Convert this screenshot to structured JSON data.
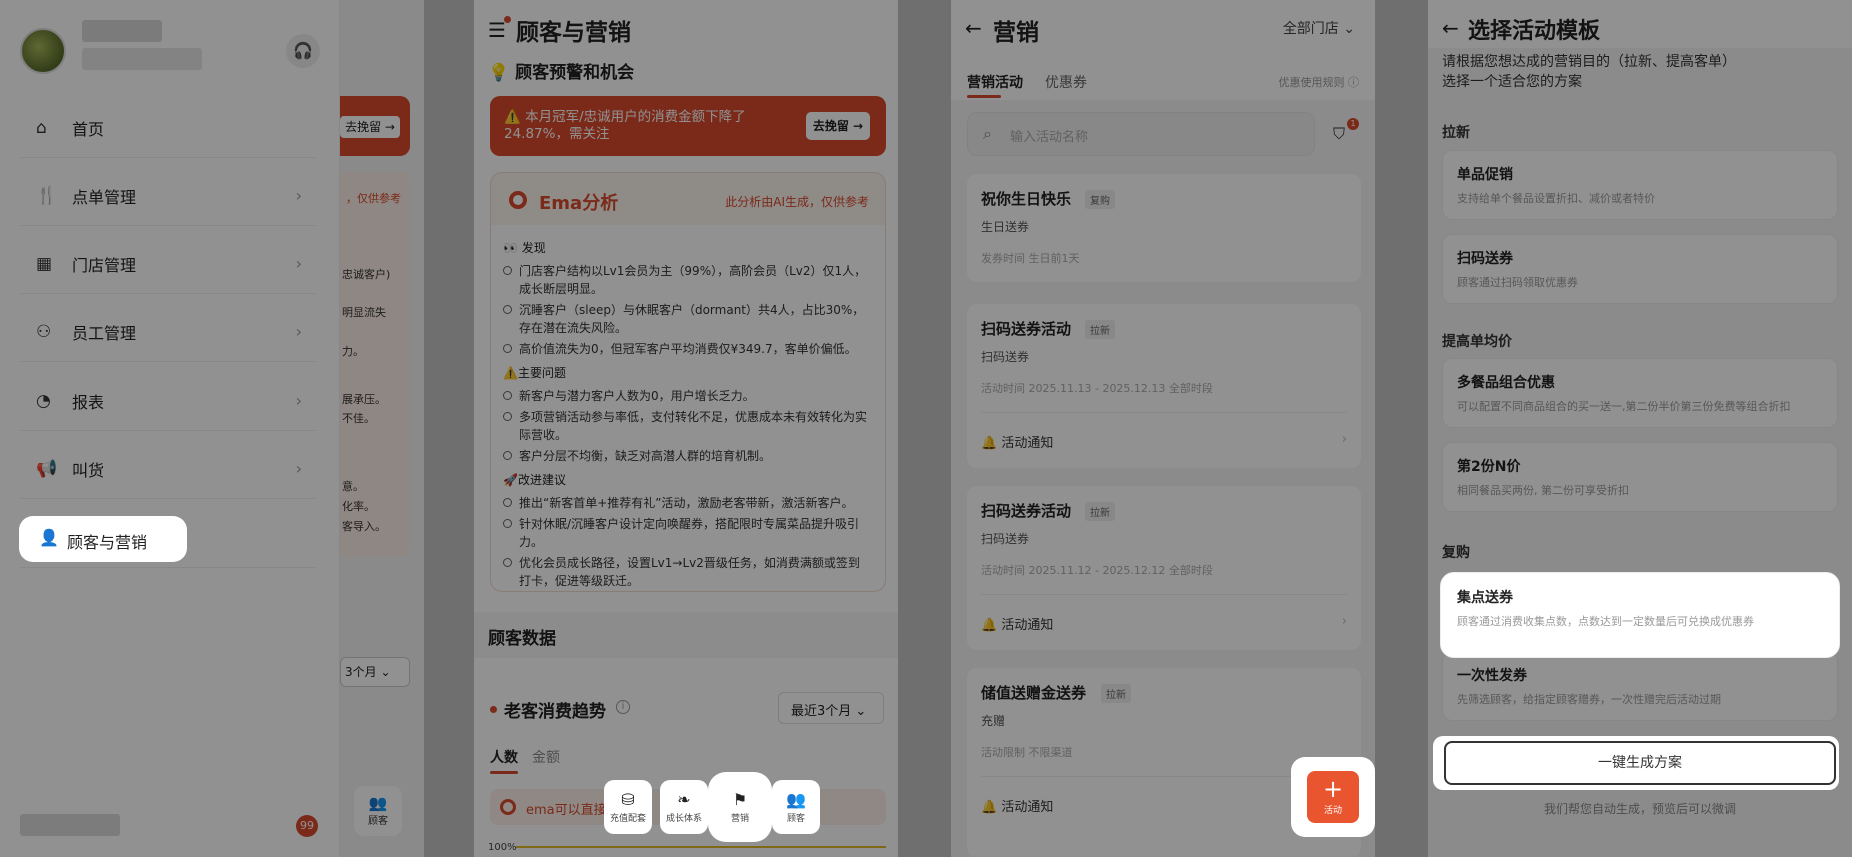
{
  "panel1": {
    "menu": [
      {
        "label": "首页",
        "icon": "home-icon",
        "glyph": "⌂",
        "chevron": false
      },
      {
        "label": "点单管理",
        "icon": "cutlery-icon",
        "glyph": "🍴",
        "chevron": true
      },
      {
        "label": "门店管理",
        "icon": "store-icon",
        "glyph": "▦",
        "chevron": true
      },
      {
        "label": "员工管理",
        "icon": "staff-icon",
        "glyph": "⚇",
        "chevron": true
      },
      {
        "label": "报表",
        "icon": "pie-chart-icon",
        "glyph": "◔",
        "chevron": true
      },
      {
        "label": "叫货",
        "icon": "megaphone-icon",
        "glyph": "📢",
        "chevron": true
      },
      {
        "label": "顾客与营销",
        "icon": "customer-marketing-icon",
        "glyph": "👤",
        "chevron": false
      }
    ],
    "badge": "99",
    "behind": {
      "button": "去挽留 →",
      "warn": "，仅供参考",
      "lines": [
        "忠诚客户)",
        "明显流失",
        "力。",
        "展承压。",
        "不佳。",
        "意。",
        "化率。",
        "客导入。"
      ],
      "select": "3个月 ⌄",
      "mini": "顾客"
    }
  },
  "panel2": {
    "title": "顾客与营销",
    "section": "顾客预警和机会",
    "alert": "⚠️ 本月冠军/忠诚用户的消费金额下降了24.87%，需关注",
    "alert_button": "去挽留 →",
    "ema_title": "Ema分析",
    "ema_note": "此分析由AI生成，仅供参考",
    "find_head": "👀 发现",
    "find": [
      "门店客户结构以Lv1会员为主（99%），高阶会员（Lv2）仅1人，成长断层明显。",
      "沉睡客户（sleep）与休眠客户（dormant）共4人，占比30%，存在潜在流失风险。",
      "高价值流失为0，但冠军客户平均消费仅¥349.7，客单价偏低。"
    ],
    "issue_head": "⚠️主要问题",
    "issues": [
      "新客户与潜力客户人数为0，用户增长乏力。",
      "多项营销活动参与率低，支付转化不足，优惠成本未有效转化为实际营收。",
      "客户分层不均衡，缺乏对高潜人群的培育机制。"
    ],
    "suggest_head": "🚀改进建议",
    "suggests": [
      "推出“新客首单+推荐有礼”活动，激励老客带新，激活新客户。",
      "针对休眠/沉睡客户设计定向唤醒券，搭配限时专属菜品提升吸引力。",
      "优化会员成长路径，设置Lv1→Lv2晋级任务，如消费满额或签到打卡，促进等级跃迁。"
    ],
    "customer_data": "顾客数据",
    "trend_title": "老客消费趋势",
    "trend_select": "最近3个月 ⌄",
    "tabs": [
      "人数",
      "金额"
    ],
    "ema_hint": "ema可以直接帮你",
    "ema_hint_tail": "哦",
    "pct": "100%",
    "bottom_nav": [
      {
        "label": "充值配套",
        "icon": "recharge-icon",
        "glyph": "⛁"
      },
      {
        "label": "成长体系",
        "icon": "leaf-icon",
        "glyph": "❧"
      },
      {
        "label": "营销",
        "icon": "flag-icon",
        "glyph": "⚑"
      },
      {
        "label": "顾客",
        "icon": "customers-icon",
        "glyph": "👥"
      }
    ]
  },
  "panel3": {
    "title": "营销",
    "store": "全部门店 ⌄",
    "tabs": [
      "营销活动",
      "优惠券"
    ],
    "rule": "优惠使用规则 ⓘ",
    "search_placeholder": "输入活动名称",
    "filter_count": "1",
    "activities": [
      {
        "title": "祝你生日快乐",
        "tag": "复购",
        "sub": "生日送券",
        "meta": "发券时间    生日前1天",
        "notify": ""
      },
      {
        "title": "扫码送券活动",
        "tag": "拉新",
        "sub": "扫码送券",
        "meta": "活动时间    2025.11.13 - 2025.12.13    全部时段",
        "notify": "活动通知"
      },
      {
        "title": "扫码送券活动",
        "tag": "拉新",
        "sub": "扫码送券",
        "meta": "活动时间    2025.11.12 - 2025.12.12    全部时段",
        "notify": "活动通知"
      },
      {
        "title": "储值送赠金送券",
        "tag": "拉新",
        "sub": "充赠",
        "meta": "活动限制    不限渠道",
        "notify": "活动通知"
      }
    ],
    "fab_label": "活动"
  },
  "panel4": {
    "title": "选择活动模板",
    "intro": "请根据您想达成的营销目的（拉新、提高客单）选择一个适合您的方案",
    "groups": [
      {
        "name": "拉新",
        "items": [
          {
            "title": "单品促销",
            "desc": "支持给单个餐品设置折扣、减价或者特价"
          },
          {
            "title": "扫码送券",
            "desc": "顾客通过扫码领取优惠券"
          }
        ]
      },
      {
        "name": "提高单均价",
        "items": [
          {
            "title": "多餐品组合优惠",
            "desc": "可以配置不同商品组合的买一送一,第二份半价第三份免费等组合折扣"
          },
          {
            "title": "第2份N价",
            "desc": "相同餐品买两份, 第二份可享受折扣"
          }
        ]
      },
      {
        "name": "复购",
        "items": [
          {
            "title": "集点送券",
            "desc": "顾客通过消费收集点数，点数达到一定数量后可兑换成优惠券"
          },
          {
            "title": "一次性发券",
            "desc": "先筛选顾客，给指定顾客赠券，一次性赠完后活动过期"
          }
        ]
      }
    ],
    "generate": "一键生成方案",
    "generate_note": "我们帮您自动生成，预览后可以微调"
  }
}
